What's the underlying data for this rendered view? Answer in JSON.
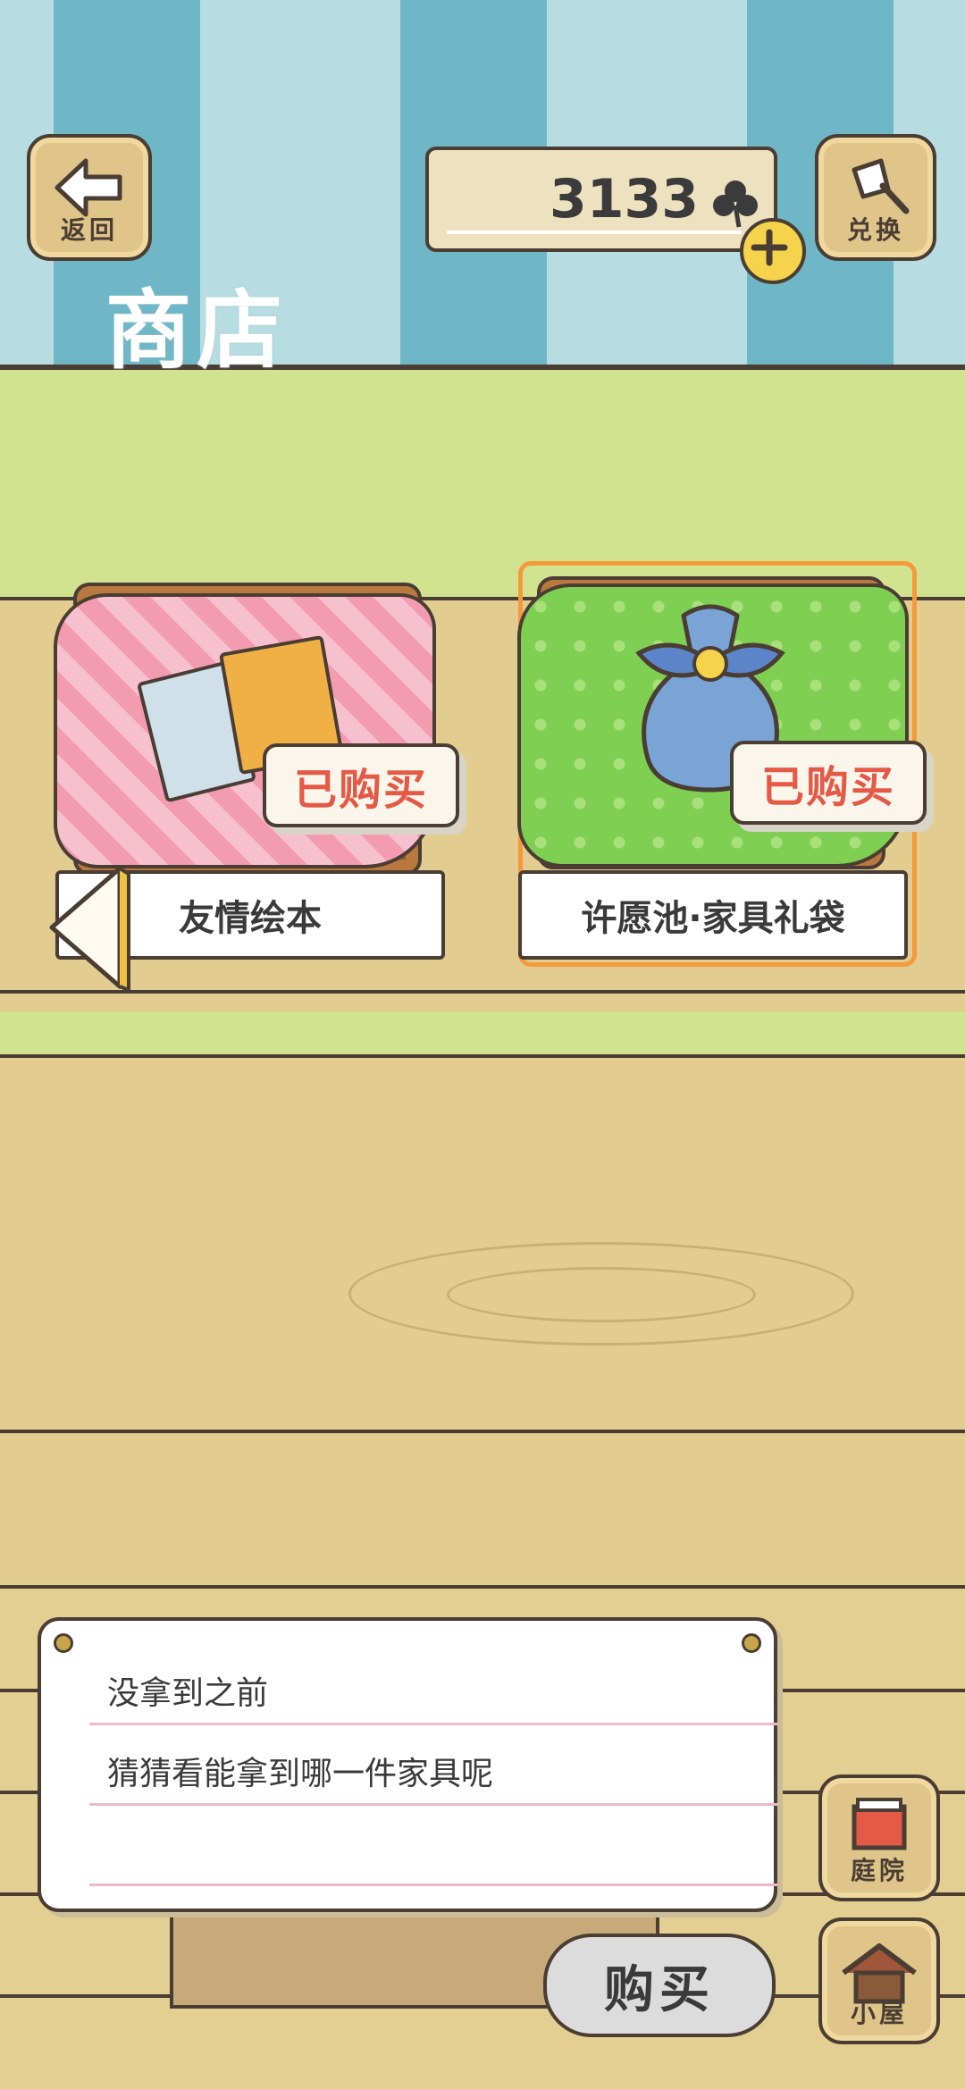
{
  "header": {
    "back_label": "返回",
    "title": "商店",
    "currency_amount": "3133",
    "exchange_label": "兑换"
  },
  "shop_items": [
    {
      "name": "友情绘本",
      "status": "已购买",
      "cloth_color": "#f39bb1"
    },
    {
      "name": "许愿池·家具礼袋",
      "status": "已购买",
      "cloth_color": "#7fcf52"
    }
  ],
  "dialog": {
    "lines": [
      "没拿到之前",
      "猜猜看能拿到哪一件家具呢",
      ""
    ]
  },
  "buttons": {
    "buy_label": "购买",
    "yard_label": "庭院",
    "house_label": "小屋"
  },
  "colors": {
    "stripe_light": "#b7dde3",
    "stripe_dark": "#6fb6c6",
    "grass": "#d1e38f",
    "wood": "#e2cc8f",
    "sold_text": "#e55a47",
    "selected_border": "#f59a3b"
  }
}
